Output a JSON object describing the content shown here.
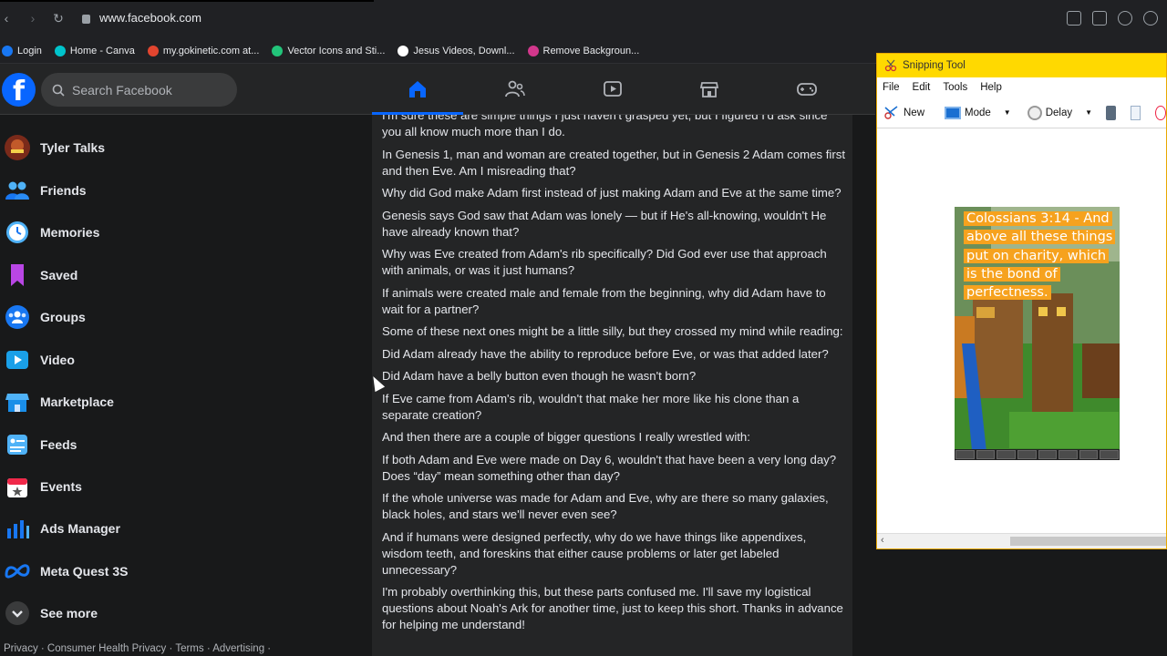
{
  "browser": {
    "url": "www.facebook.com",
    "bookmarks": [
      {
        "label": "Login",
        "color": "#1877f2"
      },
      {
        "label": "Home - Canva",
        "color": "#00c4cc"
      },
      {
        "label": "my.gokinetic.com at...",
        "color": "#e2452f"
      },
      {
        "label": "Vector Icons and Sti...",
        "color": "#22c47a"
      },
      {
        "label": "Jesus Videos, Downl...",
        "color": "#ffffff"
      },
      {
        "label": "Remove Backgroun...",
        "color": "#d2378c"
      }
    ]
  },
  "facebook": {
    "search_placeholder": "Search Facebook",
    "accent": "#0866ff",
    "sidebar": [
      {
        "label": "Tyler Talks",
        "icon": "profile-avatar-icon"
      },
      {
        "label": "Friends",
        "icon": "friends-icon"
      },
      {
        "label": "Memories",
        "icon": "memories-clock-icon"
      },
      {
        "label": "Saved",
        "icon": "bookmark-icon"
      },
      {
        "label": "Groups",
        "icon": "groups-icon"
      },
      {
        "label": "Video",
        "icon": "video-icon"
      },
      {
        "label": "Marketplace",
        "icon": "marketplace-icon"
      },
      {
        "label": "Feeds",
        "icon": "feeds-icon"
      },
      {
        "label": "Events",
        "icon": "events-icon"
      },
      {
        "label": "Ads Manager",
        "icon": "ads-manager-icon"
      },
      {
        "label": "Meta Quest 3S",
        "icon": "meta-icon"
      },
      {
        "label": "See more",
        "icon": "chevron-down-icon"
      }
    ],
    "footer": "Privacy · Consumer Health Privacy · Terms · Advertising ·",
    "post_paragraphs": [
      "I'm sure these are simple things I just haven't grasped yet, but I figured I'd ask since you all know much more than I do.",
      "In Genesis 1, man and woman are created together, but in Genesis 2 Adam comes first and then Eve. Am I misreading that?",
      "Why did God make Adam first instead of just making Adam and Eve at the same time?",
      "Genesis says God saw that Adam was lonely — but if He's all-knowing, wouldn't He have already known that?",
      "Why was Eve created from Adam's rib specifically? Did God ever use that approach with animals, or was it just humans?",
      "If animals were created male and female from the beginning, why did Adam have to wait for a partner?",
      "Some of these next ones might be a little silly, but they crossed my mind while reading:",
      "Did Adam already have the ability to reproduce before Eve, or was that added later?",
      "Did Adam have a belly button even though he wasn't born?",
      "If Eve came from Adam's rib, wouldn't that make her more like his clone than a separate creation?",
      "And then there are a couple of bigger questions I really wrestled with:",
      "If both Adam and Eve were made on Day 6, wouldn't that have been a very long day? Does “day” mean something other than day?",
      "If the whole universe was made for Adam and Eve, why are there so many galaxies, black holes, and stars we'll never even see?",
      "And if humans were designed perfectly, why do we have things like appendixes, wisdom teeth, and foreskins that either cause problems or later get labeled unnecessary?",
      "I'm probably overthinking this, but these parts confused me. I'll save my logistical questions about Noah's Ark for another time, just to keep this short. Thanks in advance for helping me understand!"
    ]
  },
  "snipping_tool": {
    "title": "Snipping Tool",
    "menu": [
      "File",
      "Edit",
      "Tools",
      "Help"
    ],
    "toolbar": {
      "new": "New",
      "mode": "Mode",
      "delay": "Delay"
    },
    "capture_text": "Colossians 3:14 - And above all these things put on charity, which is the bond of perfectness."
  }
}
